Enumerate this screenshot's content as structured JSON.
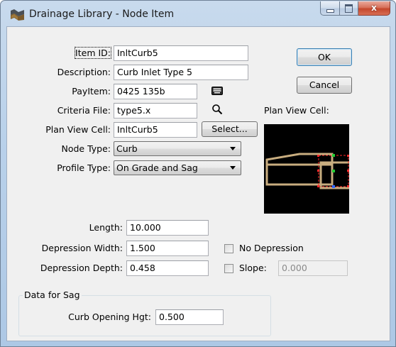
{
  "window": {
    "title": "Drainage Library - Node Item",
    "caption_buttons": {
      "minimize_icon": "minimize-icon",
      "maximize_icon": "maximize-icon",
      "close_icon": "close-icon",
      "close_glyph": "x"
    },
    "app_icon": "drainage-library-icon"
  },
  "form": {
    "item_id": {
      "label": "Item ID:",
      "value": "InltCurb5"
    },
    "description": {
      "label": "Description:",
      "value": "Curb Inlet Type 5"
    },
    "pay_item": {
      "label": "PayItem:",
      "value": "0425  135b",
      "icon": "keyboard-icon"
    },
    "criteria_file": {
      "label": "Criteria File:",
      "value": "type5.x",
      "icon": "search-icon"
    },
    "plan_view_cell": {
      "label": "Plan View Cell:",
      "value": "InltCurb5",
      "select_label": "Select..."
    },
    "node_type": {
      "label": "Node Type:",
      "value": "Curb"
    },
    "profile_type": {
      "label": "Profile Type:",
      "value": "On Grade and Sag"
    },
    "plan_view_preview_label": "Plan View Cell:"
  },
  "buttons": {
    "ok": "OK",
    "cancel": "Cancel"
  },
  "dimensions": {
    "length": {
      "label": "Length:",
      "value": "10.000"
    },
    "depression_width": {
      "label": "Depression Width:",
      "value": "1.500"
    },
    "depression_depth": {
      "label": "Depression Depth:",
      "value": "0.458"
    },
    "no_depression": {
      "label": "No Depression",
      "checked": false
    },
    "slope": {
      "label": "Slope:",
      "value": "0.000",
      "checked": false
    }
  },
  "sag_group": {
    "title": "Data for Sag",
    "curb_opening_hgt": {
      "label": "Curb Opening Hgt:",
      "value": "0.500"
    }
  },
  "colors": {
    "cell_outline": "#c8ad7f",
    "cell_background": "#000000",
    "marker_red": "#ff2a2a",
    "marker_green": "#22cc33",
    "marker_blue": "#3366ff"
  }
}
